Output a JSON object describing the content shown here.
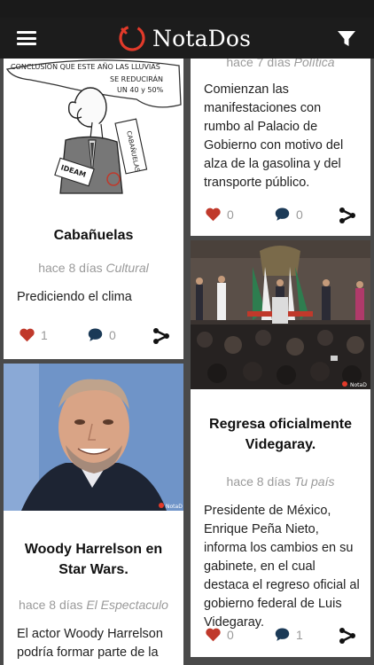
{
  "app": {
    "name": "NotaDos"
  },
  "header": {
    "logo_text": "NotaDos"
  },
  "cards": [
    {
      "title": "Cabañuelas",
      "time": "hace 8 días",
      "category": "Cultural",
      "excerpt": "Prediciendo el clima",
      "likes": "1",
      "comments": "0",
      "cartoon_text": [
        "CONCLUSION QUE ESTE AÑO LAS LLUVIAS",
        "SE REDUCIRÁN",
        "UN 40 y 50%",
        "CABAÑUELAS",
        "IDEAM"
      ]
    },
    {
      "title": "",
      "time": "hace 7 días",
      "category": "Política",
      "excerpt": "Comienzan las manifestaciones con rumbo al Palacio de Gobierno con motivo del alza de la gasolina y del transporte público.",
      "likes": "0",
      "comments": "0"
    },
    {
      "title": "Regresa oficialmente Videgaray.",
      "time": "hace 8 días",
      "category": "Tu país",
      "excerpt": "Presidente de México, Enrique Peña Nieto, informa los cambios en su gabinete, en el cual destaca el regreso oficial al gobierno federal de Luis Videgaray.",
      "likes": "0",
      "comments": "1",
      "watermark": "NotaD"
    },
    {
      "title": "Woody Harrelson en Star Wars.",
      "time": "hace 8 días",
      "category": "El Espectaculo",
      "excerpt": "El actor Woody Harrelson podría formar parte de la historia de Star Wars",
      "watermark": "NotaD"
    }
  ],
  "colors": {
    "like": "#c0392b",
    "comment": "#1b3a57",
    "share": "#111111",
    "navbar": "#1c1c1c",
    "logo_ring": "#e23a2a"
  }
}
